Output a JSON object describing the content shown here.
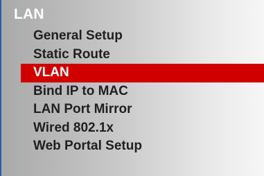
{
  "menu": {
    "section_title": "LAN",
    "active_color": "#d00000",
    "items": [
      {
        "label": "General Setup",
        "active": false
      },
      {
        "label": "Static Route",
        "active": false
      },
      {
        "label": "VLAN",
        "active": true
      },
      {
        "label": "Bind IP to MAC",
        "active": false
      },
      {
        "label": "LAN Port Mirror",
        "active": false
      },
      {
        "label": "Wired 802.1x",
        "active": false
      },
      {
        "label": "Web Portal Setup",
        "active": false
      }
    ]
  }
}
